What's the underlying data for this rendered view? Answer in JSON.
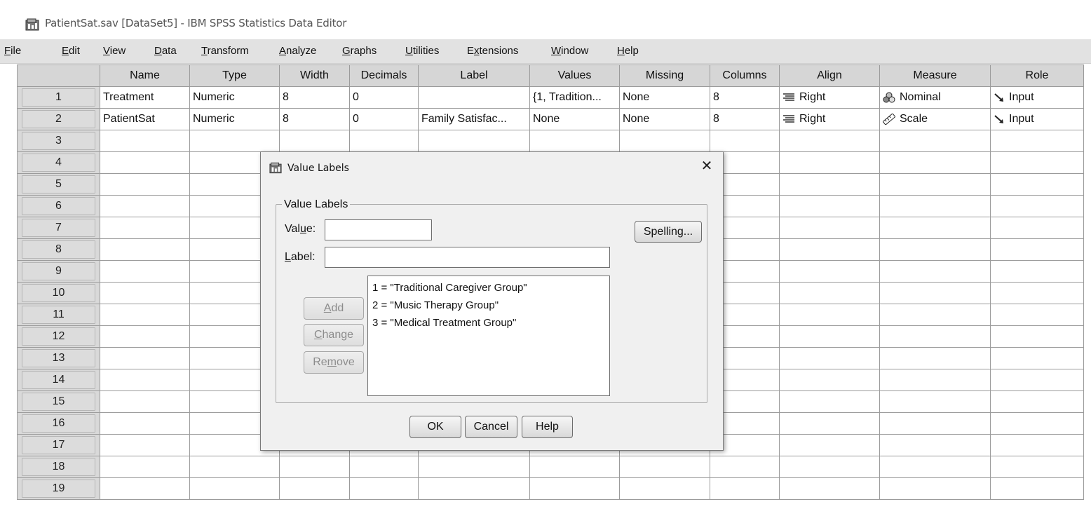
{
  "window": {
    "title": "PatientSat.sav [DataSet5] - IBM SPSS Statistics Data Editor"
  },
  "menu": [
    {
      "pre": "",
      "acc": "F",
      "post": "ile"
    },
    {
      "pre": "",
      "acc": "E",
      "post": "dit"
    },
    {
      "pre": "",
      "acc": "V",
      "post": "iew"
    },
    {
      "pre": "",
      "acc": "D",
      "post": "ata"
    },
    {
      "pre": "",
      "acc": "T",
      "post": "ransform"
    },
    {
      "pre": "",
      "acc": "A",
      "post": "nalyze"
    },
    {
      "pre": "",
      "acc": "G",
      "post": "raphs"
    },
    {
      "pre": "",
      "acc": "U",
      "post": "tilities"
    },
    {
      "pre": "E",
      "acc": "x",
      "post": "tensions"
    },
    {
      "pre": "",
      "acc": "W",
      "post": "indow"
    },
    {
      "pre": "",
      "acc": "H",
      "post": "elp"
    }
  ],
  "grid": {
    "columns": [
      "Name",
      "Type",
      "Width",
      "Decimals",
      "Label",
      "Values",
      "Missing",
      "Columns",
      "Align",
      "Measure",
      "Role"
    ],
    "rows": [
      {
        "num": "1",
        "cells": [
          "Treatment",
          "Numeric",
          "8",
          "0",
          "",
          "{1, Tradition...",
          "None",
          "8",
          "Right",
          "Nominal",
          "Input"
        ],
        "measure_icon": "nominal-icon"
      },
      {
        "num": "2",
        "cells": [
          "PatientSat",
          "Numeric",
          "8",
          "0",
          "Family Satisfac...",
          "None",
          "None",
          "8",
          "Right",
          "Scale",
          "Input"
        ],
        "measure_icon": "scale-icon"
      }
    ],
    "empty_row_numbers": [
      "3",
      "4",
      "5",
      "6",
      "7",
      "8",
      "9",
      "10",
      "11",
      "12",
      "13",
      "14",
      "15",
      "16",
      "17",
      "18",
      "19"
    ]
  },
  "dialog": {
    "title": "Value Labels",
    "group_label": "Value Labels",
    "value_label": {
      "pre": "Val",
      "acc": "u",
      "post": "e:"
    },
    "label_label": {
      "pre": "",
      "acc": "L",
      "post": "abel:"
    },
    "value_input": "",
    "label_input": "",
    "spelling_button": "Spelling...",
    "add_button": {
      "pre": "",
      "acc": "A",
      "post": "dd"
    },
    "change_button": {
      "pre": "",
      "acc": "C",
      "post": "hange"
    },
    "remove_button": {
      "pre": "Re",
      "acc": "m",
      "post": "ove"
    },
    "labels_list": [
      "1 = \"Traditional Caregiver Group\"",
      "2 = \"Music Therapy Group\"",
      "3 = \"Medical Treatment Group\""
    ],
    "ok_button": "OK",
    "cancel_button": "Cancel",
    "help_button": "Help"
  },
  "colors": {
    "menubar_bg": "#e2e2e2",
    "header_bg": "#d6d6d6",
    "dialog_bg": "#f0f0f0"
  }
}
